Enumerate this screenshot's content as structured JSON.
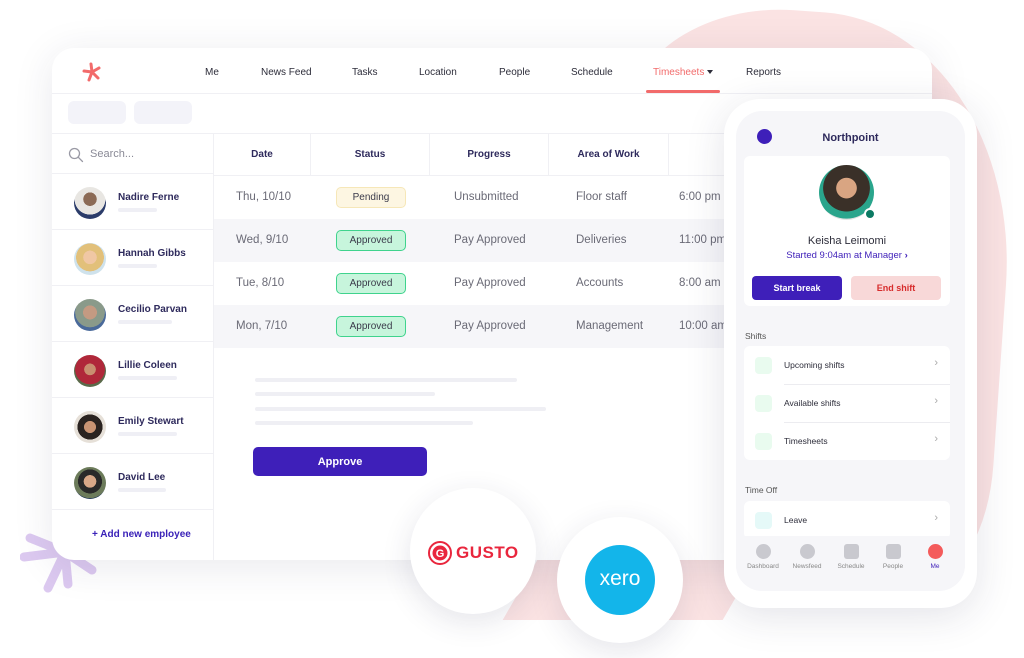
{
  "nav": {
    "items": [
      {
        "label": "Me"
      },
      {
        "label": "News Feed"
      },
      {
        "label": "Tasks"
      },
      {
        "label": "Location"
      },
      {
        "label": "People"
      },
      {
        "label": "Schedule"
      },
      {
        "label": "Timesheets",
        "active": true,
        "has_dropdown": true
      },
      {
        "label": "Reports"
      }
    ],
    "accent": "#f26b6b"
  },
  "sidebar": {
    "search_placeholder": "Search...",
    "employees": [
      {
        "name": "Nadire Ferne"
      },
      {
        "name": "Hannah Gibbs"
      },
      {
        "name": "Cecilio Parvan"
      },
      {
        "name": "Lillie Coleen"
      },
      {
        "name": "Emily Stewart"
      },
      {
        "name": "David Lee"
      }
    ],
    "add_label": "+ Add new employee"
  },
  "table": {
    "headers": [
      "Date",
      "Status",
      "Progress",
      "Area of Work",
      ""
    ],
    "rows": [
      {
        "date": "Thu, 10/10",
        "status": "Pending",
        "progress": "Unsubmitted",
        "area": "Floor staff",
        "time": "6:00 pm"
      },
      {
        "date": "Wed, 9/10",
        "status": "Approved",
        "progress": "Pay Approved",
        "area": "Deliveries",
        "time": "11:00 pm"
      },
      {
        "date": "Tue, 8/10",
        "status": "Approved",
        "progress": "Pay Approved",
        "area": "Accounts",
        "time": "8:00 am"
      },
      {
        "date": "Mon, 7/10",
        "status": "Approved",
        "progress": "Pay Approved",
        "area": "Management",
        "time": "10:00 am"
      }
    ],
    "approve_label": "Approve"
  },
  "integrations": {
    "gusto": "GUSTO",
    "xero": "xero"
  },
  "phone": {
    "location": "Northpoint",
    "user_name": "Keisha Leimomi",
    "started": "Started 9:04am at Manager",
    "start_break": "Start break",
    "end_shift": "End shift",
    "shifts_title": "Shifts",
    "shifts": [
      {
        "label": "Upcoming shifts"
      },
      {
        "label": "Available shifts"
      },
      {
        "label": "Timesheets"
      }
    ],
    "timeoff_title": "Time Off",
    "timeoff": [
      {
        "label": "Leave"
      }
    ],
    "tabs": [
      {
        "label": "Dashboard",
        "icon": "dashboard-icon"
      },
      {
        "label": "Newsfeed",
        "icon": "newsfeed-icon"
      },
      {
        "label": "Schedule",
        "icon": "schedule-icon"
      },
      {
        "label": "People",
        "icon": "people-icon"
      },
      {
        "label": "Me",
        "icon": "me-icon",
        "active": true
      }
    ]
  }
}
